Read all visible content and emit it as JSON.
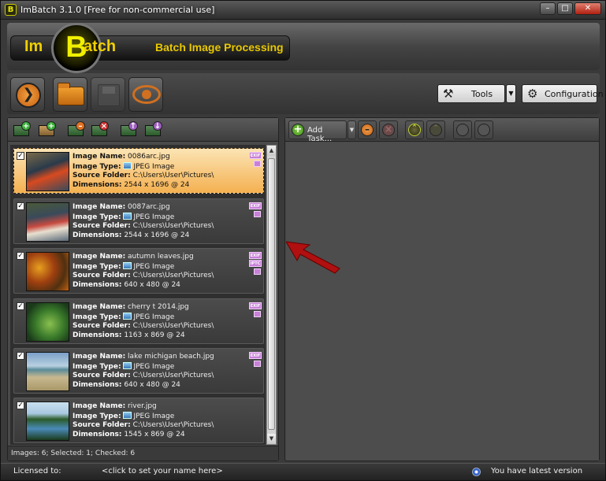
{
  "window": {
    "title": "ImBatch 3.1.0 [Free for non-commercial use]",
    "logo_letter": "B"
  },
  "banner": {
    "logo_left": "Im",
    "logo_big": "B",
    "logo_right": "atch",
    "subtitle": "Batch Image Processing"
  },
  "toolbar": {
    "tools_label": "Tools",
    "config_label": "Configuration",
    "run_icon": "play-circle-icon",
    "open_icon": "folder-icon",
    "save_icon": "disk-icon",
    "preview_icon": "eye-icon"
  },
  "right_toolbar": {
    "add_task_label": "Add Task..."
  },
  "images": [
    {
      "name": "0086arc.jpg",
      "type": "JPEG Image",
      "folder": "C:\\Users\\User\\Pictures\\",
      "dimensions": "2544 x 1696 @ 24",
      "tags": [
        "EXIF"
      ],
      "checked": true,
      "selected": true
    },
    {
      "name": "0087arc.jpg",
      "type": "JPEG Image",
      "folder": "C:\\Users\\User\\Pictures\\",
      "dimensions": "2544 x 1696 @ 24",
      "tags": [
        "EXIF"
      ],
      "checked": true,
      "selected": false
    },
    {
      "name": "autumn leaves.jpg",
      "type": "JPEG Image",
      "folder": "C:\\Users\\User\\Pictures\\",
      "dimensions": "640 x 480 @ 24",
      "tags": [
        "EXIF",
        "IPTC"
      ],
      "checked": true,
      "selected": false
    },
    {
      "name": "cherry t 2014.jpg",
      "type": "JPEG Image",
      "folder": "C:\\Users\\User\\Pictures\\",
      "dimensions": "1163 x 869 @ 24",
      "tags": [
        "EXIF"
      ],
      "checked": true,
      "selected": false
    },
    {
      "name": "lake michigan beach.jpg",
      "type": "JPEG Image",
      "folder": "C:\\Users\\User\\Pictures\\",
      "dimensions": "640 x 480 @ 24",
      "tags": [
        "EXIF"
      ],
      "checked": true,
      "selected": false
    },
    {
      "name": "river.jpg",
      "type": "JPEG Image",
      "folder": "C:\\Users\\User\\Pictures\\",
      "dimensions": "1545 x 869 @ 24",
      "tags": [],
      "checked": true,
      "selected": false
    }
  ],
  "labels": {
    "image_name": "Image Name:",
    "image_type": "Image Type:",
    "source_folder": "Source Folder:",
    "dimensions": "Dimensions:"
  },
  "list_status": "Images: 6; Selected: 1; Checked: 6",
  "statusbar": {
    "licensed": "Licensed to:",
    "name_placeholder": "<click to set your name here>",
    "version": "You have latest version"
  },
  "colors": {
    "accent": "#f4b050",
    "logo": "#f0d000",
    "arrow": "#b01010"
  }
}
